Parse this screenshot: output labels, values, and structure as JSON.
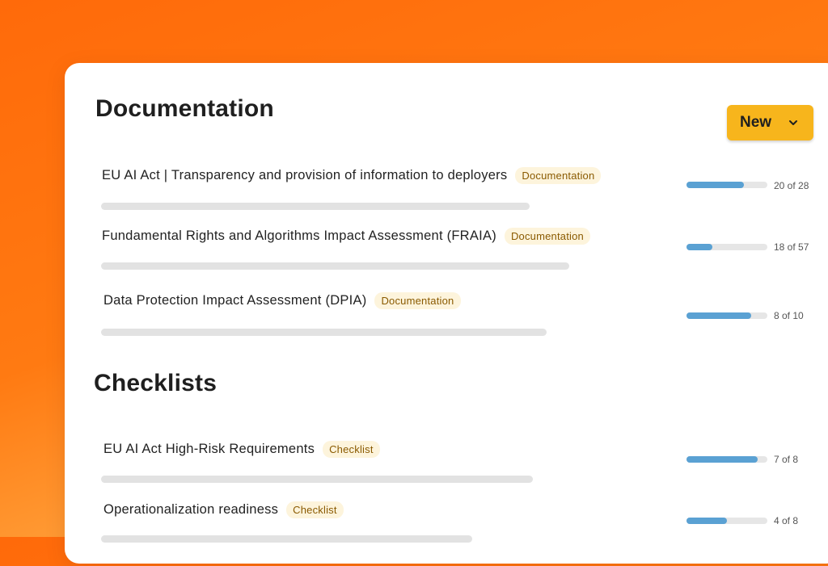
{
  "documentation": {
    "title": "Documentation",
    "new_button_label": "New",
    "items": [
      {
        "name": "EU AI Act | Transparency and provision of information to deployers",
        "tag": "Documentation",
        "count": "20 of 28",
        "done": 20,
        "total": 28
      },
      {
        "name": "Fundamental Rights and Algorithms Impact Assessment (FRAIA)",
        "tag": "Documentation",
        "count": "18 of 57",
        "done": 18,
        "total": 57
      },
      {
        "name": "Data Protection Impact Assessment (DPIA)",
        "tag": "Documentation",
        "count": "8 of 10",
        "done": 8,
        "total": 10
      }
    ]
  },
  "checklists": {
    "title": "Checklists",
    "items": [
      {
        "name": "EU AI Act High-Risk Requirements",
        "tag": "Checklist",
        "count": "7 of 8",
        "done": 7,
        "total": 8
      },
      {
        "name": "Operationalization readiness",
        "tag": "Checklist",
        "count": "4 of 8",
        "done": 4,
        "total": 8
      }
    ]
  },
  "colors": {
    "accent_button": "#f7b51c",
    "progress_fill": "#5aa1d3",
    "tag_bg": "#fdf4dc"
  },
  "icons": {
    "new_button_chevron": "chevron-down-icon"
  }
}
